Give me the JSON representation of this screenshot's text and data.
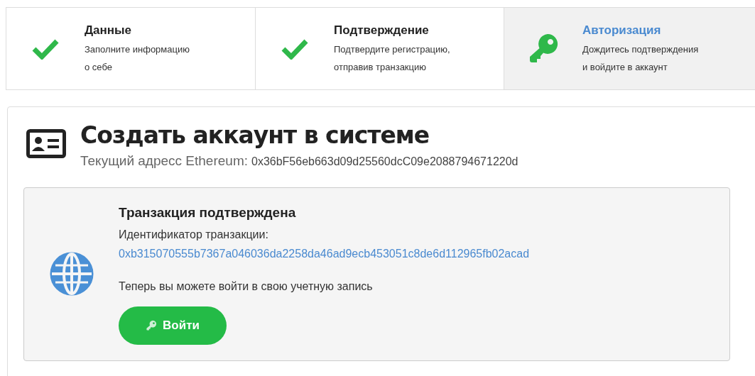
{
  "steps": [
    {
      "kind": "check",
      "title": "Данные",
      "description": [
        "Заполните информацию",
        "о себе"
      ],
      "selected": false
    },
    {
      "kind": "check",
      "title": "Подтверждение",
      "description": [
        "Подтвердите регистрацию,",
        "отправив транзакцию"
      ],
      "selected": false
    },
    {
      "kind": "key",
      "title": "Авторизация",
      "description": [
        "Дождитесь подтверждения",
        "и войдите в аккаунт"
      ],
      "selected": true
    }
  ],
  "card": {
    "title": "Создать аккаунт в системе",
    "address_label": "Текущий адресс Ethereum:",
    "address": "0x36bF56eb663d09d25560dcC09e2088794671220d",
    "notice": {
      "title": "Транзакция подтверждена",
      "id_label": "Идентификатор транзакции:",
      "tx_hash": "0xb315070555b7367a046036da2258da46ad9ecb453051c8de6d112965fb02acad",
      "message": "Теперь вы можете войти в свою учетную запись",
      "button": "Войти"
    }
  }
}
